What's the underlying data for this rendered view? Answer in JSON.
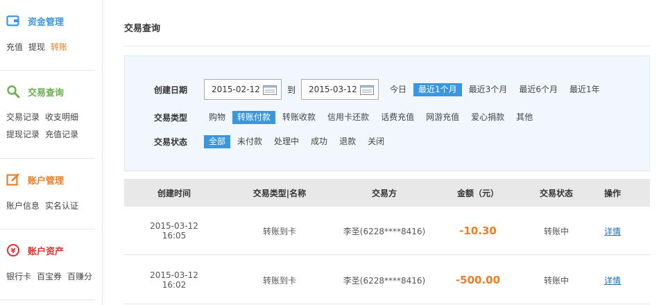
{
  "colors": {
    "accent_blue": "#3a96dd",
    "accent_orange": "#f07c22",
    "green": "#6ab04c",
    "red": "#e0302b"
  },
  "sidebar": {
    "sections": [
      {
        "title": "资金管理",
        "icon": "wallet-icon",
        "links": [
          "充值",
          "提现",
          "转账"
        ],
        "active": "转账"
      },
      {
        "title": "交易查询",
        "icon": "search-icon",
        "links": [
          "交易记录",
          "收支明细",
          "提现记录",
          "充值记录"
        ]
      },
      {
        "title": "账户管理",
        "icon": "edit-icon",
        "links": [
          "账户信息",
          "实名认证"
        ]
      },
      {
        "title": "账户资产",
        "icon": "yen-icon",
        "links": [
          "银行卡",
          "百宝券",
          "百赚分"
        ]
      }
    ]
  },
  "main": {
    "title": "交易查询",
    "filter": {
      "date_label": "创建日期",
      "date_from": "2015-02-12",
      "date_to": "2015-03-12",
      "to_label": "到",
      "date_ranges": [
        "今日",
        "最近1个月",
        "最近3个月",
        "最近6个月",
        "最近1年"
      ],
      "date_range_selected": "最近1个月",
      "type_label": "交易类型",
      "types": [
        "购物",
        "转账付款",
        "转账收款",
        "信用卡还款",
        "话费充值",
        "网游充值",
        "爱心捐款",
        "其他"
      ],
      "type_selected": "转账付款",
      "status_label": "交易状态",
      "statuses": [
        "全部",
        "未付款",
        "处理中",
        "成功",
        "退款",
        "关闭"
      ],
      "status_selected": "全部"
    },
    "table": {
      "columns": [
        "创建时间",
        "交易类型|名称",
        "交易方",
        "金额（元）",
        "交易状态",
        "操作"
      ],
      "rows": [
        {
          "date": "2015-03-12",
          "time": "16:05",
          "type": "转账到卡",
          "party": "李圣(6228****8416)",
          "amount": "-10.30",
          "status": "转账中",
          "action": "详情"
        },
        {
          "date": "2015-03-12",
          "time": "16:02",
          "type": "转账到卡",
          "party": "李圣(6228****8416)",
          "amount": "-500.00",
          "status": "转账中",
          "action": "详情"
        }
      ]
    }
  }
}
